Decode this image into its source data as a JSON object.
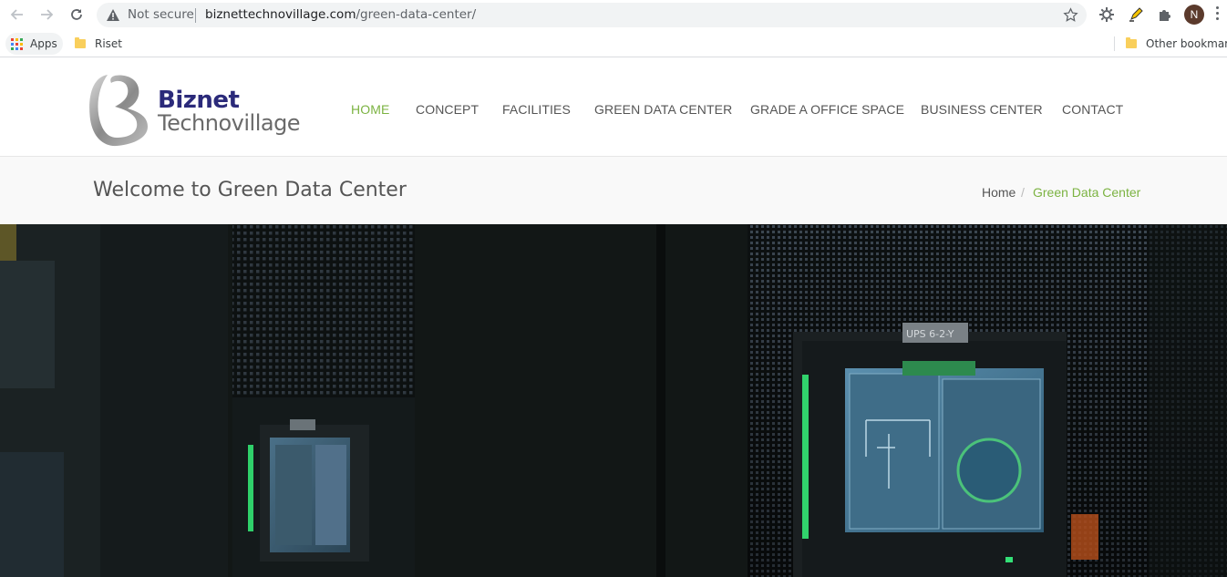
{
  "browser": {
    "security_label": "Not secure",
    "url_host": "biznettechnovillage.com",
    "url_path": "/green-data-center/",
    "profile_initial": "N",
    "icons": [
      "back-arrow-icon",
      "forward-arrow-icon",
      "reload-icon",
      "warning-icon",
      "star-icon",
      "extension-gear-icon",
      "highlighter-icon",
      "puzzle-icon",
      "menu-dots-icon"
    ]
  },
  "bookmarks": {
    "apps_label": "Apps",
    "items": [
      {
        "label": "Riset"
      }
    ],
    "other_label": "Other bookmarks"
  },
  "site": {
    "logo_line1": "Biznet",
    "logo_line2": "Technovillage",
    "nav": [
      {
        "label": "HOME",
        "active": true
      },
      {
        "label": "CONCEPT",
        "active": false
      },
      {
        "label": "FACILITIES",
        "active": false
      },
      {
        "label": "GREEN DATA CENTER",
        "active": false
      },
      {
        "label": "GRADE A OFFICE SPACE",
        "active": false
      },
      {
        "label": "BUSINESS CENTER",
        "active": false
      },
      {
        "label": "CONTACT",
        "active": false
      }
    ],
    "accent_color": "#7cb342",
    "page_title": "Welcome to Green Data Center",
    "breadcrumb": {
      "home": "Home",
      "separator": "/",
      "current": "Green Data Center"
    },
    "hero": {
      "panel_label": "UPS 6-2-Y"
    }
  }
}
